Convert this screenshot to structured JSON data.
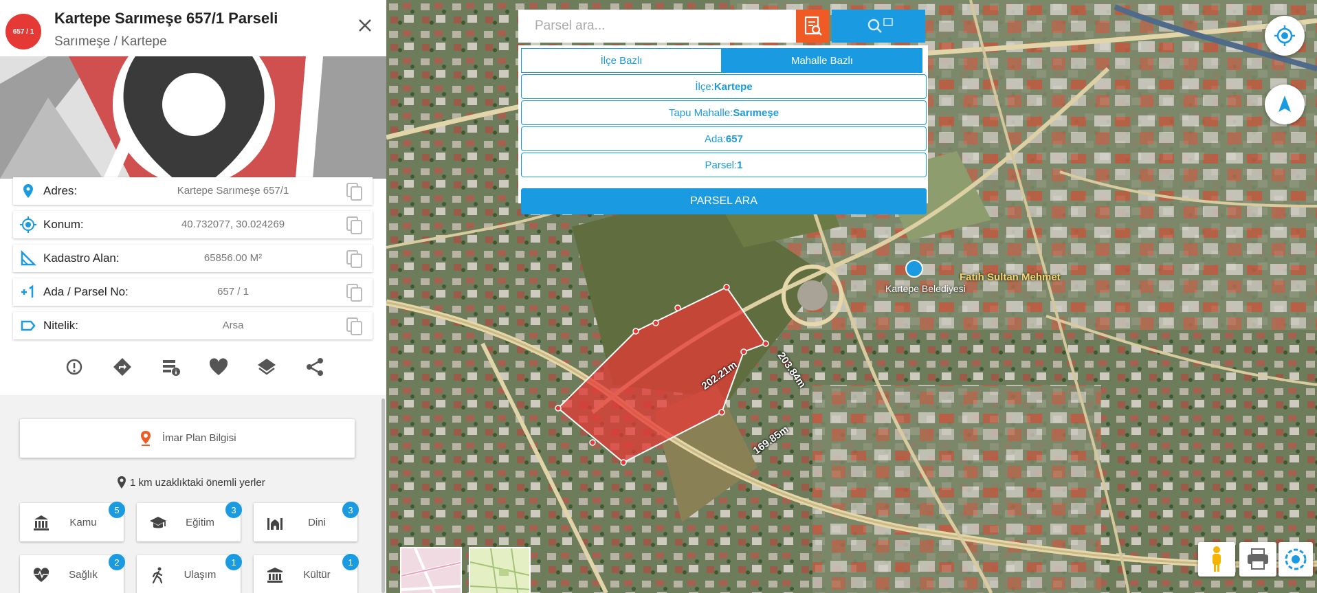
{
  "parcel": {
    "badge": "657 / 1",
    "title": "Kartepe Sarımeşe 657/1 Parseli",
    "subtitle": "Sarımeşe / Kartepe"
  },
  "info": [
    {
      "label": "Adres:",
      "value": "Kartepe Sarımeşe 657/1",
      "icon": "location-pin-icon"
    },
    {
      "label": "Konum:",
      "value": "40.732077, 30.024269",
      "icon": "crosshair-icon"
    },
    {
      "label": "Kadastro Alan:",
      "value": "65856.00 M²",
      "icon": "area-ruler-icon"
    },
    {
      "label": "Ada / Parsel No:",
      "value": "657 / 1",
      "icon": "plus-one-icon"
    },
    {
      "label": "Nitelik:",
      "value": "Arsa",
      "icon": "tag-icon"
    }
  ],
  "actions": [
    "report-icon",
    "directions-icon",
    "details-icon",
    "favorite-icon",
    "layers-icon",
    "share-icon"
  ],
  "imar": {
    "label": "İmar Plan Bilgisi"
  },
  "nearby": {
    "title": "1 km uzaklıktaki önemli yerler",
    "categories": [
      {
        "label": "Kamu",
        "count": "5",
        "icon": "government-building-icon"
      },
      {
        "label": "Eğitim",
        "count": "3",
        "icon": "graduation-cap-icon"
      },
      {
        "label": "Dini",
        "count": "3",
        "icon": "mosque-icon"
      },
      {
        "label": "Sağlık",
        "count": "2",
        "icon": "heart-pulse-icon"
      },
      {
        "label": "Ulaşım",
        "count": "1",
        "icon": "walking-person-icon"
      },
      {
        "label": "Kültür",
        "count": "1",
        "icon": "museum-icon"
      }
    ]
  },
  "search": {
    "placeholder": "Parsel ara...",
    "tabs": [
      "İlçe Bazlı",
      "Mahalle Bazlı"
    ],
    "active_tab": "Mahalle Bazlı",
    "fields": [
      {
        "label": "İlçe:",
        "value": "Kartepe"
      },
      {
        "label": "Tapu Mahalle:",
        "value": "Sarımeşe"
      },
      {
        "label": "Ada:",
        "value": "657"
      },
      {
        "label": "Parsel:",
        "value": "1"
      }
    ],
    "submit": "PARSEL ARA"
  },
  "map": {
    "dimensions": [
      "202.21m",
      "203.84m",
      "169.85m"
    ],
    "poi": {
      "name": "Kartepe Belediyesi",
      "place": "Fatih Sultan Mehmet"
    }
  },
  "colors": {
    "accent": "#1a9ae0",
    "orange": "#f05a24",
    "badge": "#e53935",
    "parcel": "#e53935"
  }
}
